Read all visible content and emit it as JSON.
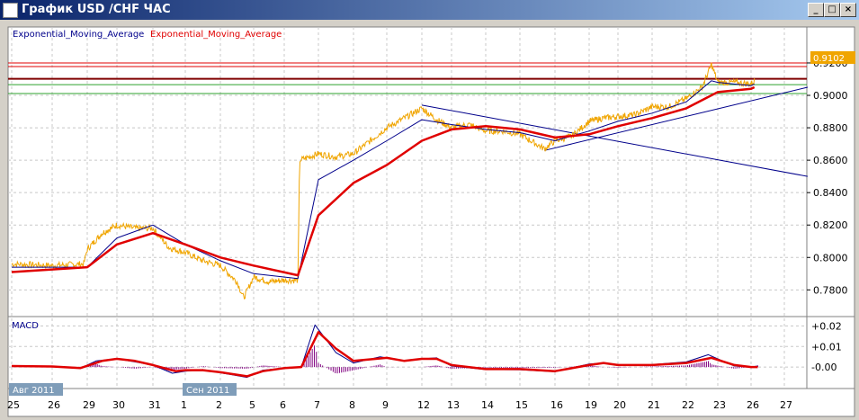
{
  "window": {
    "title": "График USD /CHF  ЧАС",
    "buttons": [
      "_",
      "□",
      "×"
    ]
  },
  "legend": {
    "ema1": "Exponential_Moving_Average",
    "ema2": "Exponential_Moving_Average"
  },
  "macd_label": "MACD",
  "current_price": "0.9102",
  "colors": {
    "price": "#f0a500",
    "ema_fast": "#00008b",
    "ema_slow": "#e00000",
    "hist": "#800080",
    "price_tag": "#f0a500"
  },
  "chart_data": {
    "type": "line",
    "title": "График USD /CHF  ЧАС",
    "x_tick_labels": [
      "25",
      "26",
      "29",
      "30",
      "31",
      "1",
      "2",
      "5",
      "6",
      "7",
      "8",
      "9",
      "12",
      "13",
      "14",
      "15",
      "16",
      "19",
      "20",
      "21",
      "22",
      "23",
      "26",
      "27"
    ],
    "month_labels": [
      {
        "label": "Авг 2011",
        "at": 0
      },
      {
        "label": "Сен 2011",
        "at": 5
      }
    ],
    "y_tick_labels": [
      "0.9200",
      "0.9000",
      "0.8800",
      "0.8600",
      "0.8400",
      "0.8200",
      "0.8000",
      "0.7800"
    ],
    "ylim": [
      0.7713,
      0.9333
    ],
    "price": [
      [
        0,
        0.796
      ],
      [
        1,
        0.795
      ],
      [
        1.9,
        0.796
      ],
      [
        2,
        0.805
      ],
      [
        2.5,
        0.815
      ],
      [
        3,
        0.82
      ],
      [
        3.5,
        0.818
      ],
      [
        4,
        0.818
      ],
      [
        4.5,
        0.806
      ],
      [
        5,
        0.803
      ],
      [
        5.5,
        0.798
      ],
      [
        6,
        0.795
      ],
      [
        6.5,
        0.785
      ],
      [
        6.7,
        0.775
      ],
      [
        7,
        0.788
      ],
      [
        7.5,
        0.785
      ],
      [
        8,
        0.786
      ],
      [
        8.4,
        0.786
      ],
      [
        8.45,
        0.86
      ],
      [
        9,
        0.864
      ],
      [
        9.5,
        0.862
      ],
      [
        10,
        0.864
      ],
      [
        10.5,
        0.872
      ],
      [
        11,
        0.88
      ],
      [
        11.5,
        0.886
      ],
      [
        12,
        0.892
      ],
      [
        12.5,
        0.885
      ],
      [
        13,
        0.88
      ],
      [
        13.5,
        0.882
      ],
      [
        14,
        0.878
      ],
      [
        14.5,
        0.878
      ],
      [
        15,
        0.876
      ],
      [
        15.7,
        0.867
      ],
      [
        16,
        0.872
      ],
      [
        16.5,
        0.875
      ],
      [
        17,
        0.884
      ],
      [
        17.5,
        0.886
      ],
      [
        18,
        0.887
      ],
      [
        18.5,
        0.888
      ],
      [
        19,
        0.893
      ],
      [
        19.5,
        0.893
      ],
      [
        20,
        0.898
      ],
      [
        20.5,
        0.905
      ],
      [
        20.8,
        0.919
      ],
      [
        21,
        0.908
      ],
      [
        21.5,
        0.908
      ],
      [
        22,
        0.907
      ],
      [
        22.1,
        0.909
      ]
    ],
    "ema_fast": [
      [
        0,
        0.794
      ],
      [
        2,
        0.794
      ],
      [
        3,
        0.812
      ],
      [
        4,
        0.82
      ],
      [
        5,
        0.808
      ],
      [
        6,
        0.798
      ],
      [
        7,
        0.79
      ],
      [
        8.4,
        0.787
      ],
      [
        9,
        0.848
      ],
      [
        10,
        0.86
      ],
      [
        11,
        0.872
      ],
      [
        12,
        0.885
      ],
      [
        13,
        0.882
      ],
      [
        14,
        0.879
      ],
      [
        15,
        0.877
      ],
      [
        16,
        0.872
      ],
      [
        17,
        0.878
      ],
      [
        18,
        0.884
      ],
      [
        19,
        0.889
      ],
      [
        20,
        0.896
      ],
      [
        20.8,
        0.909
      ],
      [
        21,
        0.908
      ],
      [
        22,
        0.906
      ],
      [
        22.1,
        0.907
      ]
    ],
    "ema_slow": [
      [
        0,
        0.791
      ],
      [
        2,
        0.794
      ],
      [
        3,
        0.808
      ],
      [
        4,
        0.815
      ],
      [
        5,
        0.808
      ],
      [
        6,
        0.8
      ],
      [
        7,
        0.795
      ],
      [
        8.4,
        0.789
      ],
      [
        9,
        0.826
      ],
      [
        10,
        0.846
      ],
      [
        11,
        0.857
      ],
      [
        12,
        0.872
      ],
      [
        13,
        0.879
      ],
      [
        14,
        0.881
      ],
      [
        15,
        0.879
      ],
      [
        16,
        0.874
      ],
      [
        17,
        0.876
      ],
      [
        18,
        0.881
      ],
      [
        19,
        0.886
      ],
      [
        20,
        0.892
      ],
      [
        21,
        0.902
      ],
      [
        22,
        0.904
      ],
      [
        22.1,
        0.905
      ]
    ],
    "hlines": [
      {
        "value": 0.92,
        "color": "#e00000"
      },
      {
        "value": 0.9178,
        "color": "#e00000"
      },
      {
        "value": 0.9102,
        "color": "#800000"
      },
      {
        "value": 0.9066,
        "color": "#2ca02c"
      },
      {
        "value": 0.9011,
        "color": "#2ca02c"
      }
    ],
    "trendlines": [
      {
        "from": [
          12,
          0.894
        ],
        "to": [
          23.7,
          0.85
        ]
      },
      {
        "from": [
          15.7,
          0.866
        ],
        "to": [
          23.7,
          0.905
        ]
      }
    ],
    "macd": {
      "y_tick_labels": [
        "+0.02",
        "+0.01",
        "-0.00"
      ],
      "ylim": [
        -0.0065,
        0.0215
      ],
      "macd": [
        [
          0,
          0.0006
        ],
        [
          1,
          0.0004
        ],
        [
          1.8,
          -0.0006
        ],
        [
          2.3,
          0.003
        ],
        [
          3,
          0.004
        ],
        [
          3.5,
          0.0025
        ],
        [
          4,
          0.001
        ],
        [
          4.6,
          -0.003
        ],
        [
          5,
          -0.002
        ],
        [
          5.5,
          -0.0012
        ],
        [
          6,
          -0.0028
        ],
        [
          6.8,
          -0.005
        ],
        [
          7.3,
          -0.0015
        ],
        [
          8,
          -0.0005
        ],
        [
          8.5,
          0
        ],
        [
          8.9,
          0.0205
        ],
        [
          9.5,
          0.007
        ],
        [
          10,
          0.002
        ],
        [
          10.8,
          0.005
        ],
        [
          11.5,
          0.003
        ],
        [
          12,
          0.004
        ],
        [
          12.5,
          0.0045
        ],
        [
          13,
          0.0005
        ],
        [
          14,
          -0.0012
        ],
        [
          15,
          -0.0013
        ],
        [
          16,
          -0.0022
        ],
        [
          17,
          0.0015
        ],
        [
          17.5,
          0.002
        ],
        [
          18,
          0.0008
        ],
        [
          19,
          0.0012
        ],
        [
          20,
          0.0025
        ],
        [
          20.7,
          0.006
        ],
        [
          21.5,
          0.0005
        ],
        [
          22,
          0
        ],
        [
          22.2,
          0.0005
        ]
      ],
      "signal": [
        [
          0,
          0.0005
        ],
        [
          1,
          0.0003
        ],
        [
          1.8,
          -0.0005
        ],
        [
          2.5,
          0.003
        ],
        [
          3,
          0.004
        ],
        [
          3.5,
          0.003
        ],
        [
          4,
          0.001
        ],
        [
          4.7,
          -0.002
        ],
        [
          5,
          -0.0015
        ],
        [
          5.5,
          -0.0015
        ],
        [
          6,
          -0.0025
        ],
        [
          6.8,
          -0.0045
        ],
        [
          7.3,
          -0.002
        ],
        [
          8,
          -0.0005
        ],
        [
          8.5,
          0
        ],
        [
          9,
          0.017
        ],
        [
          9.5,
          0.009
        ],
        [
          10,
          0.003
        ],
        [
          11,
          0.0045
        ],
        [
          11.5,
          0.003
        ],
        [
          12,
          0.004
        ],
        [
          12.5,
          0.004
        ],
        [
          13,
          0.001
        ],
        [
          14,
          -0.001
        ],
        [
          15,
          -0.001
        ],
        [
          16,
          -0.002
        ],
        [
          17,
          0.001
        ],
        [
          17.5,
          0.002
        ],
        [
          18,
          0.001
        ],
        [
          19,
          0.001
        ],
        [
          20,
          0.002
        ],
        [
          20.8,
          0.0045
        ],
        [
          21.5,
          0.001
        ],
        [
          22,
          0
        ],
        [
          22.2,
          0
        ]
      ]
    }
  }
}
